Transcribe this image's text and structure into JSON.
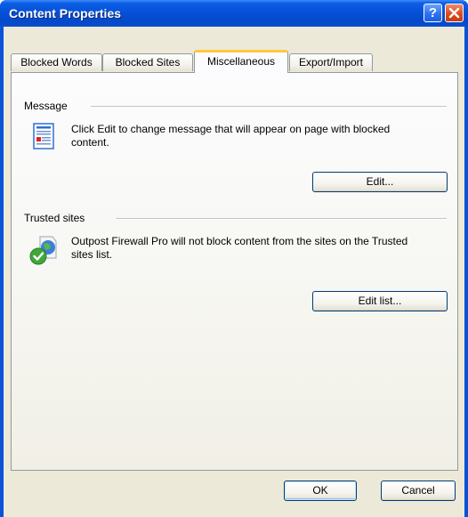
{
  "window": {
    "title": "Content Properties",
    "help_label": "?"
  },
  "tabs": [
    {
      "label": "Blocked Words",
      "active": false
    },
    {
      "label": "Blocked Sites",
      "active": false
    },
    {
      "label": "Miscellaneous",
      "active": true
    },
    {
      "label": "Export/Import",
      "active": false
    }
  ],
  "message_section": {
    "label": "Message",
    "description": "Click Edit to change message that will appear on page with blocked content.",
    "icon": "document-icon",
    "button_label": "Edit..."
  },
  "trusted_section": {
    "label": "Trusted sites",
    "description": "Outpost Firewall Pro will not block content from the sites on the Trusted sites list.",
    "icon": "trusted-globe-icon",
    "button_label": "Edit list..."
  },
  "footer": {
    "ok_label": "OK",
    "cancel_label": "Cancel"
  },
  "colors": {
    "titlebar": "#0651d8",
    "dialog_face": "#ece9d8",
    "active_tab_accent": "#ffc83c",
    "close_button": "#dc4a1e"
  }
}
